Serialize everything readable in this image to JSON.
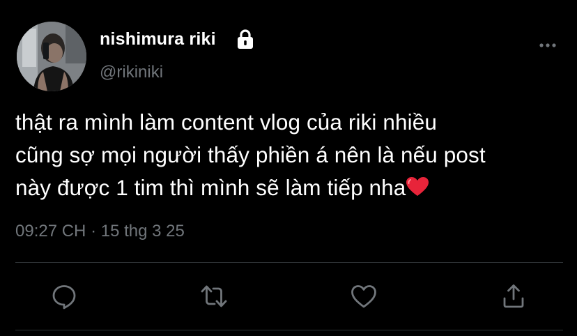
{
  "user": {
    "display_name": "nishimura riki",
    "handle": "@rikiniki",
    "protected": true,
    "avatar_icon": "profile-photo"
  },
  "tweet": {
    "lines": [
      "thật ra mình làm content vlog của riki nhiều",
      "cũng sợ mọi người thấy phiền á nên là nếu post",
      "này được 1 tim thì mình sẽ làm tiếp nha"
    ],
    "emoji": "red-heart",
    "time": "09:27 CH",
    "separator": "·",
    "date": "15 thg 3 25"
  },
  "actions": [
    {
      "name": "reply",
      "icon": "reply-icon"
    },
    {
      "name": "retweet",
      "icon": "retweet-icon"
    },
    {
      "name": "like",
      "icon": "heart-icon"
    },
    {
      "name": "share",
      "icon": "share-icon"
    }
  ],
  "colors": {
    "background": "#000000",
    "primary_text": "#ffffff",
    "secondary_text": "#71767b",
    "divider": "#2f3336",
    "heart_emoji": "#e8243a"
  }
}
